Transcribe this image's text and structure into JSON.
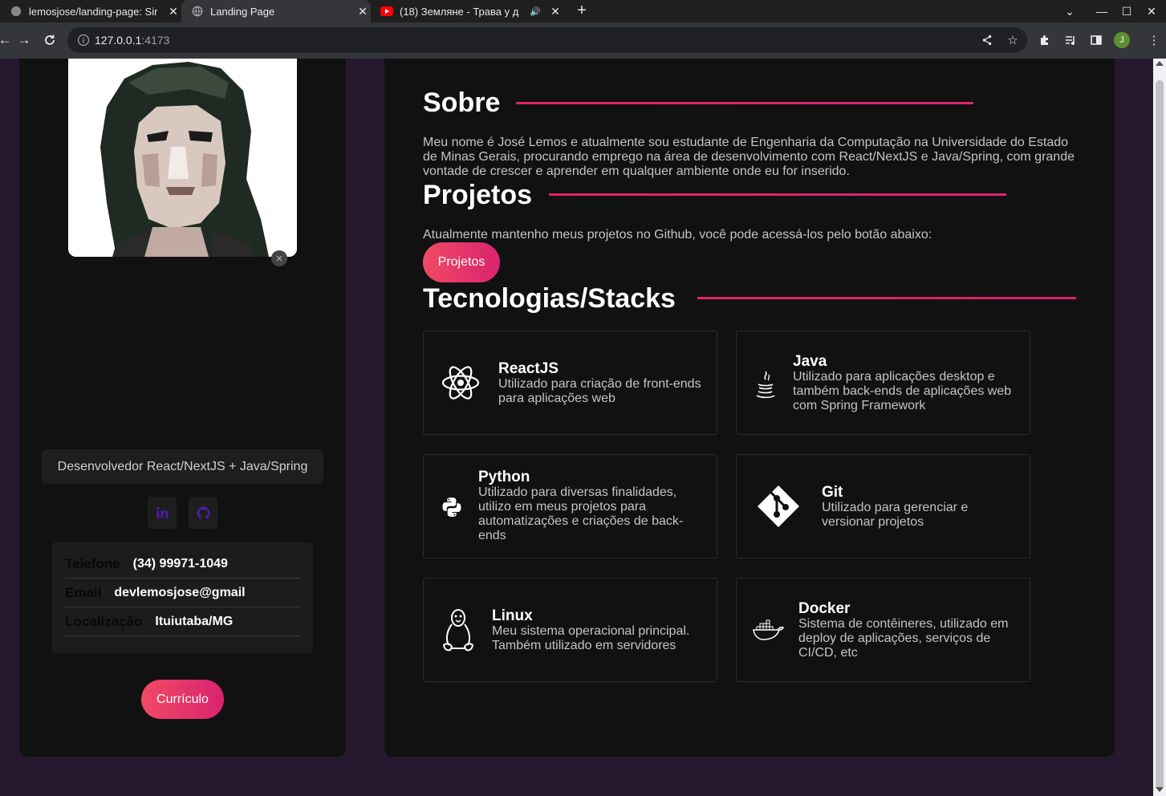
{
  "browser": {
    "tabs": [
      {
        "title": "lemosjose/landing-page: Sir",
        "active": false
      },
      {
        "title": "Landing Page",
        "active": true
      },
      {
        "title": "(18) Земляне - Трава у д",
        "active": false
      }
    ],
    "url_host": "127.0.0.1",
    "url_port": ":4173",
    "profile_initial": "J"
  },
  "sidebar": {
    "role": "Desenvolvedor React/NextJS + Java/Spring",
    "contact": [
      {
        "label": "Telefone",
        "value": "(34) 99971-1049"
      },
      {
        "label": "Email",
        "value": "devlemosjose@gmail"
      },
      {
        "label": "Localização",
        "value": "Ituiutaba/MG"
      }
    ],
    "cv_button": "Currículo"
  },
  "main": {
    "about": {
      "title": "Sobre",
      "text": "Meu nome é José Lemos e atualmente sou estudante de Engenharia da Computação na Universidade do Estado de Minas Gerais, procurando emprego na área de desenvolvimento com React/NextJS e Java/Spring, com grande vontade de crescer e aprender em qualquer ambiente onde eu for inserido."
    },
    "projects": {
      "title": "Projetos",
      "text": "Atualmente mantenho meus projetos no Github, você pode acessá-los pelo botão abaixo:",
      "button": "Projetos"
    },
    "stacks": {
      "title": "Tecnologias/Stacks",
      "items": [
        {
          "name": "ReactJS",
          "desc": "Utilizado para criação de front-ends para aplicações web",
          "icon": "react-icon"
        },
        {
          "name": "Java",
          "desc": "Utilizado para aplicações desktop e também back-ends de aplicações web com Spring Framework",
          "icon": "java-icon"
        },
        {
          "name": "Python",
          "desc": "Utilizado para diversas finalidades, utilizo em meus projetos para automatizações e criações de back-ends",
          "icon": "python-icon"
        },
        {
          "name": "Git",
          "desc": "Utilizado para gerenciar e versionar projetos",
          "icon": "git-icon"
        },
        {
          "name": "Linux",
          "desc": "Meu sistema operacional principal. Também utilizado em servidores",
          "icon": "linux-icon"
        },
        {
          "name": "Docker",
          "desc": "Sistema de contêineres, utilizado em deploy de aplicações, serviços de CI/CD, etc",
          "icon": "docker-icon"
        }
      ]
    }
  },
  "colors": {
    "accent": "#e0245e",
    "page_bg": "#26192f",
    "panel_bg": "#111111",
    "social_icon": "#4b1fa0"
  }
}
